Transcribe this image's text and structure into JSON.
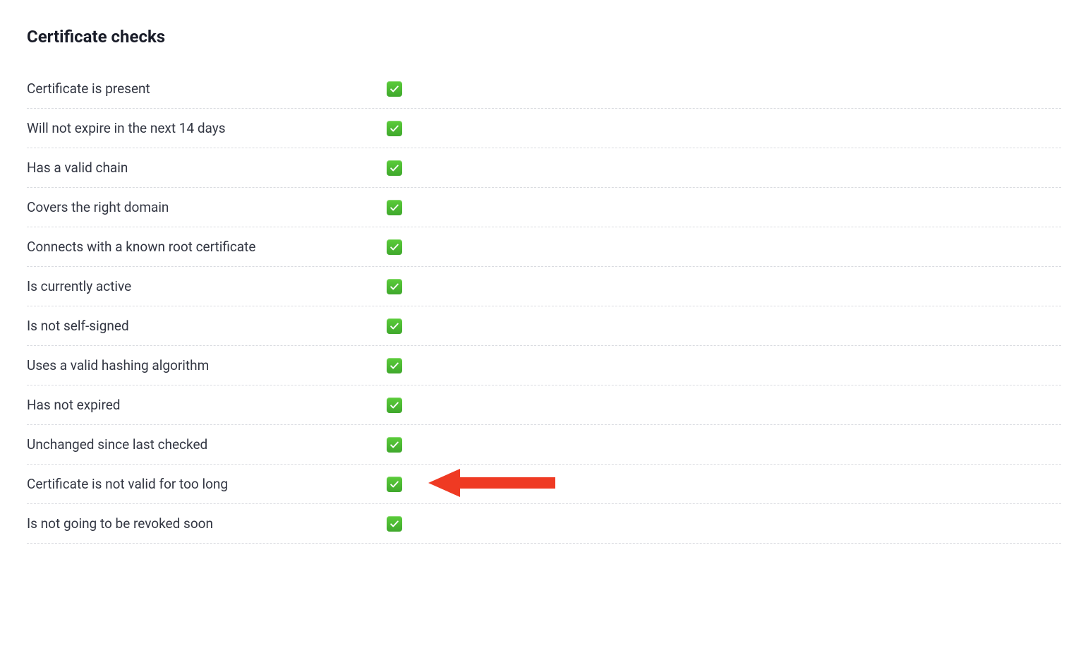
{
  "section": {
    "title": "Certificate checks"
  },
  "checks": [
    {
      "label": "Certificate is present",
      "status": "pass",
      "highlighted": false
    },
    {
      "label": "Will not expire in the next 14 days",
      "status": "pass",
      "highlighted": false
    },
    {
      "label": "Has a valid chain",
      "status": "pass",
      "highlighted": false
    },
    {
      "label": "Covers the right domain",
      "status": "pass",
      "highlighted": false
    },
    {
      "label": "Connects with a known root certificate",
      "status": "pass",
      "highlighted": false
    },
    {
      "label": "Is currently active",
      "status": "pass",
      "highlighted": false
    },
    {
      "label": "Is not self-signed",
      "status": "pass",
      "highlighted": false
    },
    {
      "label": "Uses a valid hashing algorithm",
      "status": "pass",
      "highlighted": false
    },
    {
      "label": "Has not expired",
      "status": "pass",
      "highlighted": false
    },
    {
      "label": "Unchanged since last checked",
      "status": "pass",
      "highlighted": false
    },
    {
      "label": "Certificate is not valid for too long",
      "status": "pass",
      "highlighted": true
    },
    {
      "label": "Is not going to be revoked soon",
      "status": "pass",
      "highlighted": false
    }
  ]
}
